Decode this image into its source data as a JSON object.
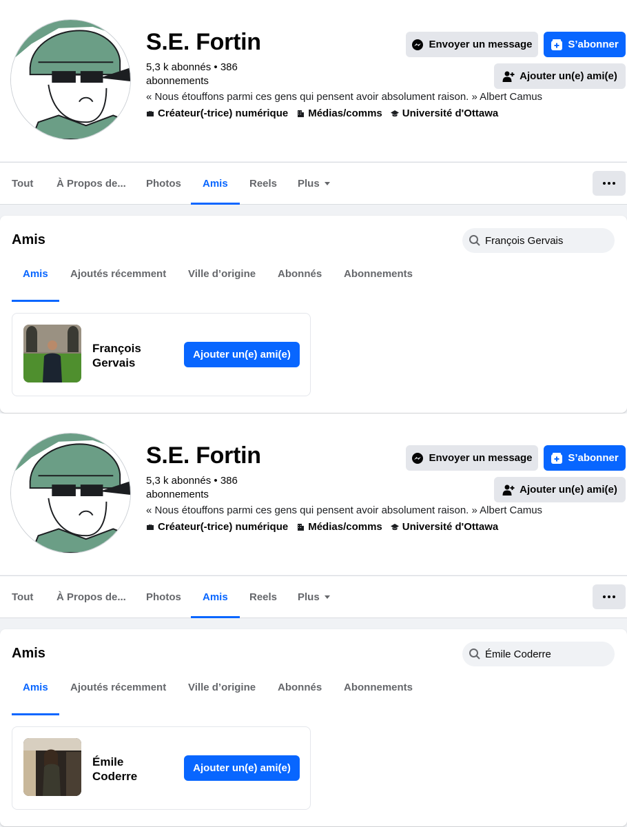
{
  "panels": [
    {
      "profile": {
        "name": "S.E. Fortin",
        "stats": "5,3 k abonnés • 386 abonnements",
        "quote": "« Nous étouffons parmi ces gens qui pensent avoir absolument raison. » Albert Camus",
        "tags": [
          "Créateur(-trice) numérique",
          "Médias/comms",
          "Université d'Ottawa"
        ],
        "message_label": "Envoyer un message",
        "subscribe_label": "S’abonner",
        "add_friend_label": "Ajouter un(e) ami(e)"
      },
      "tabs": [
        "Tout",
        "À Propos de...",
        "Photos",
        "Amis",
        "Reels",
        "Plus"
      ],
      "active_tab": "Amis",
      "friends_section": {
        "title": "Amis",
        "search_value": "François Gervais",
        "subtabs": [
          "Amis",
          "Ajoutés récemment",
          "Ville d’origine",
          "Abonnés",
          "Abonnements"
        ],
        "active_subtab": "Amis",
        "result": {
          "name": "François Gervais",
          "add_label": "Ajouter un(e) ami(e)"
        }
      }
    },
    {
      "profile": {
        "name": "S.E. Fortin",
        "stats": "5,3 k abonnés • 386 abonnements",
        "quote": "« Nous étouffons parmi ces gens qui pensent avoir absolument raison. » Albert Camus",
        "tags": [
          "Créateur(-trice) numérique",
          "Médias/comms",
          "Université d'Ottawa"
        ],
        "message_label": "Envoyer un message",
        "subscribe_label": "S’abonner",
        "add_friend_label": "Ajouter un(e) ami(e)"
      },
      "tabs": [
        "Tout",
        "À Propos de...",
        "Photos",
        "Amis",
        "Reels",
        "Plus"
      ],
      "active_tab": "Amis",
      "friends_section": {
        "title": "Amis",
        "search_value": "Émile Coderre",
        "subtabs": [
          "Amis",
          "Ajoutés récemment",
          "Ville d’origine",
          "Abonnés",
          "Abonnements"
        ],
        "active_subtab": "Amis",
        "result": {
          "name": "Émile Coderre",
          "add_label": "Ajouter un(e) ami(e)"
        }
      }
    }
  ],
  "icons": {
    "message": "messenger-icon",
    "subscribe": "subscribe-icon",
    "add_friend": "add-friend-icon",
    "tags": [
      "briefcase-icon",
      "building-icon",
      "graduation-cap-icon"
    ],
    "search": "search-icon",
    "more": "more-options-icon"
  },
  "colors": {
    "accent": "#0866ff",
    "button_grey": "#e4e6eb",
    "muted_text": "#65676b",
    "page_bg": "#f0f2f5"
  }
}
